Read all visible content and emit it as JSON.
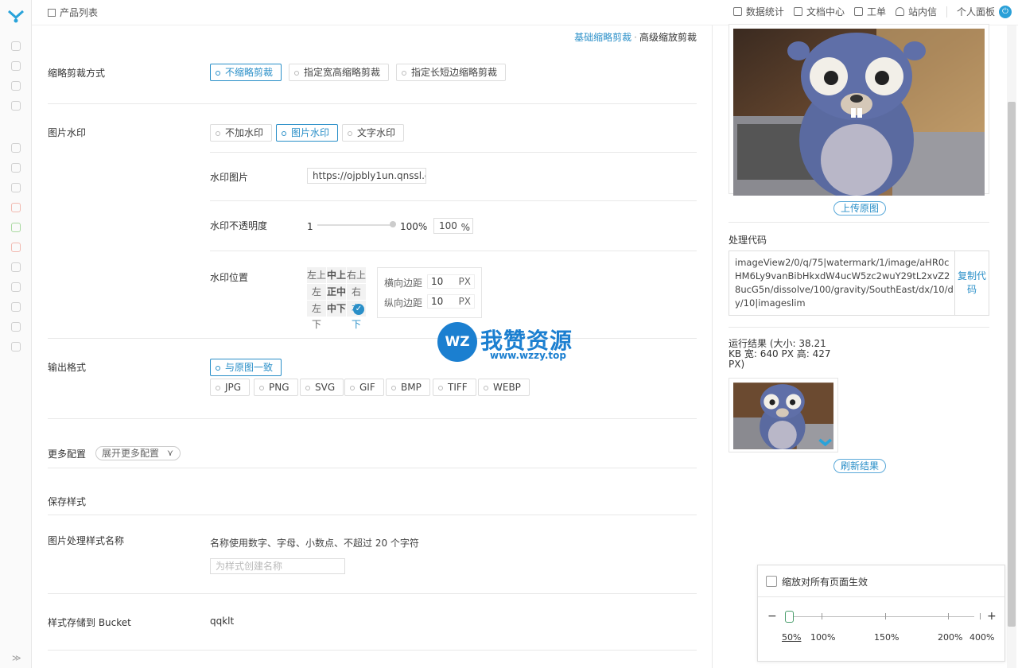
{
  "header": {
    "breadcrumb": "产品列表",
    "nav": [
      {
        "label": "数据统计",
        "icon": "chart-icon"
      },
      {
        "label": "文档中心",
        "icon": "document-icon"
      },
      {
        "label": "工单",
        "icon": "ticket-icon"
      },
      {
        "label": "站内信",
        "icon": "bell-icon"
      }
    ],
    "personal": "个人面板"
  },
  "mode_tabs": {
    "basic": "基础缩略剪裁",
    "separator": "·",
    "advanced": "高级缩放剪裁"
  },
  "crop": {
    "label": "缩略剪裁方式",
    "options": [
      "不缩略剪裁",
      "指定宽高缩略剪裁",
      "指定长短边缩略剪裁"
    ],
    "selected": "不缩略剪裁"
  },
  "watermark": {
    "label": "图片水印",
    "options": [
      "不加水印",
      "图片水印",
      "文字水印"
    ],
    "selected": "图片水印",
    "image_label": "水印图片",
    "image_url": "https://ojpbly1un.qnssl.c",
    "opacity_label": "水印不透明度",
    "opacity_min": "1",
    "opacity_max": "100%",
    "opacity_value": "100",
    "opacity_unit": "%",
    "position_label": "水印位置",
    "grid": [
      [
        "左上",
        "中上",
        "右上"
      ],
      [
        "左",
        "正中",
        "右"
      ],
      [
        "左下",
        "中下",
        "右下"
      ]
    ],
    "grid_selected": "右下",
    "h_margin_label": "横向边距",
    "h_margin": "10",
    "v_margin_label": "纵向边距",
    "v_margin": "10",
    "margin_unit": "PX"
  },
  "output": {
    "label": "输出格式",
    "primary": "与原图一致",
    "formats": [
      "JPG",
      "PNG",
      "SVG",
      "GIF",
      "BMP",
      "TIFF",
      "WEBP"
    ]
  },
  "more": {
    "label": "更多配置",
    "button": "展开更多配置"
  },
  "save": {
    "label": "保存样式"
  },
  "style_name": {
    "label": "图片处理样式名称",
    "hint": "名称使用数字、字母、小数点、不超过 20 个字符",
    "placeholder": "为样式创建名称"
  },
  "bucket": {
    "label": "样式存储到 Bucket",
    "value": "qqklt"
  },
  "right": {
    "upload_btn": "上传原图",
    "code_label": "处理代码",
    "code": "imageView2/0/q/75|watermark/1/image/aHR0cHM6Ly9vanBibHkxdW4ucW5zc2wuY29tL2xvZ28ucG5n/dissolve/100/gravity/SouthEast/dx/10/dy/10|imageslim",
    "copy_btn": "复制代码",
    "result": "运行结果 (大小: 38.21 KB 宽: 640 PX 高: 427 PX)",
    "refresh_btn": "刷新结果"
  },
  "overlay": {
    "brand": "我赞资源",
    "badge": "WZ",
    "url": "www.wzzy.top"
  },
  "zoom": {
    "checkbox_label": "缩放对所有页面生效",
    "minus": "−",
    "plus": "+",
    "levels": [
      "50%",
      "100%",
      "150%",
      "200%",
      "400%"
    ],
    "current": "50%"
  },
  "colors": {
    "accent": "#2a8fc8",
    "brand": "#1b7fd0"
  }
}
